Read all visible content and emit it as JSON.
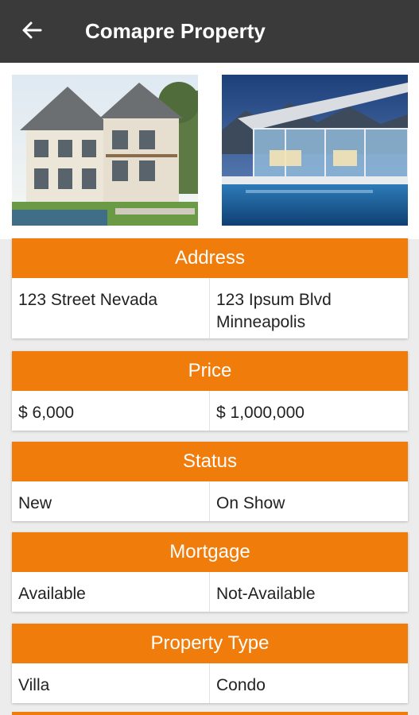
{
  "appbar": {
    "title": "Comapre Property",
    "back_icon": "arrow-back-icon"
  },
  "photos": [
    {
      "name": "property-photo-1",
      "subject": "two-story suburban house"
    },
    {
      "name": "property-photo-2",
      "subject": "modern glass house with pool"
    }
  ],
  "sections": [
    {
      "title": "Address",
      "values": [
        "123 Street Nevada",
        "123 Ipsum Blvd Minneapolis"
      ]
    },
    {
      "title": "Price",
      "values": [
        "$ 6,000",
        "$ 1,000,000"
      ]
    },
    {
      "title": "Status",
      "values": [
        "New",
        "On Show"
      ]
    },
    {
      "title": "Mortgage",
      "values": [
        "Available",
        "Not-Available"
      ]
    },
    {
      "title": "Property Type",
      "values": [
        "Villa",
        "Condo"
      ]
    }
  ],
  "colors": {
    "appbar": "#3a3a3a",
    "accent": "#f07c0b",
    "background": "#ececec"
  }
}
